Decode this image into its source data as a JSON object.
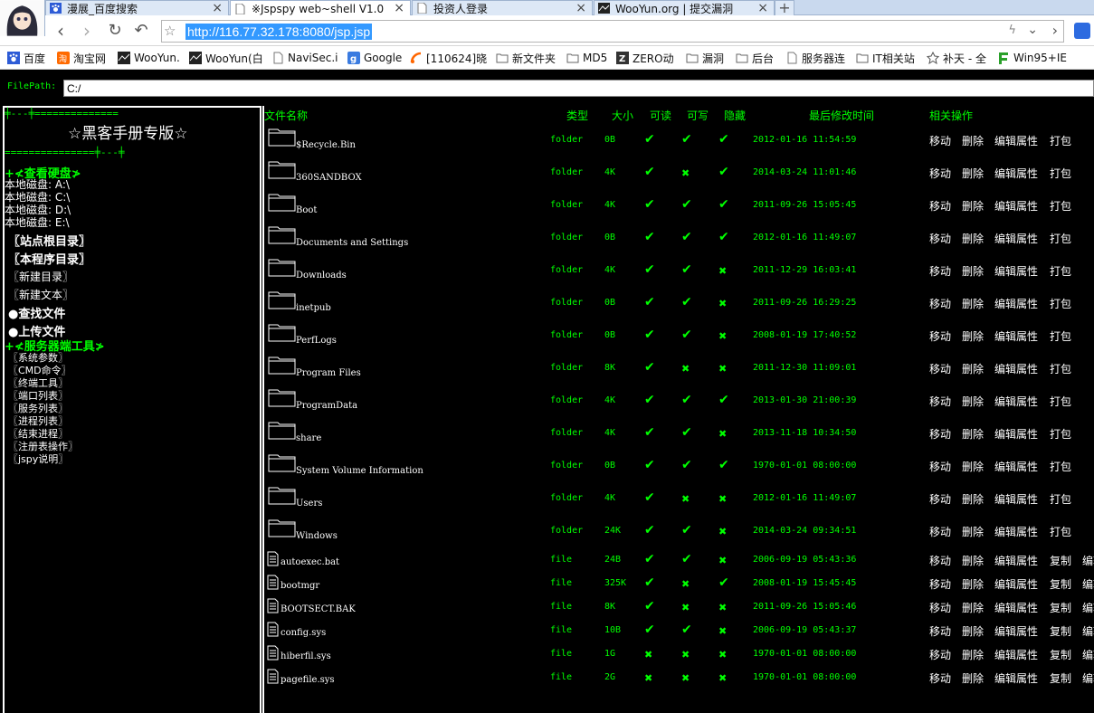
{
  "browser": {
    "tabs": [
      {
        "title": "漫展_百度搜索",
        "close": "×"
      },
      {
        "title": "※Jspspy web~shell V1.0",
        "close": "×"
      },
      {
        "title": "投资人登录",
        "close": "×"
      },
      {
        "title": "WooYun.org | 提交漏洞",
        "close": "×"
      }
    ],
    "new_tab": "+",
    "url": "http://116.77.32.178:8080/jsp.jsp",
    "bookmarks": [
      "百度",
      "淘宝网",
      "WooYun.",
      "WooYun(白",
      "NaviSec.i",
      "Google",
      "[110624]晓",
      "新文件夹",
      "MD5",
      "ZERO动",
      "漏洞",
      "后台",
      "服务器连",
      "IT相关站",
      "补天 - 全",
      "Win95+IE"
    ]
  },
  "filepath": {
    "label": "FilePath:",
    "value": "C:/"
  },
  "sidebar": {
    "top_deco": "╪---╪==============",
    "brand": "☆黑客手册专版☆",
    "bottom_deco": "===============╪---╪",
    "disks_heading": "+≮查看硬盘≯",
    "disks": [
      "本地磁盘: A:\\",
      "本地磁盘: C:\\",
      "本地磁盘: D:\\",
      "本地磁盘: E:\\"
    ],
    "site_root": "〖站点根目录〗",
    "program_dir": "〖本程序目录〗",
    "new_dir": "〖新建目录〗",
    "new_text": "〖新建文本〗",
    "search_file": "●查找文件",
    "upload_file": "●上传文件",
    "server_tools_heading": "+≮服务器端工具≯",
    "tools": [
      "〖系统参数〗",
      "〖CMD命令〗",
      "〖终端工具〗",
      "〖端口列表〗",
      "〖服务列表〗",
      "〖进程列表〗",
      "〖结束进程〗",
      "〖注册表操作〗",
      "〖jspy说明〗"
    ]
  },
  "table": {
    "headers": {
      "name": "文件名称",
      "type": "类型",
      "size": "大小",
      "read": "可读",
      "write": "可写",
      "hidden": "隐藏",
      "mtime": "最后修改时间",
      "ops": "相关操作"
    },
    "check_mark": "✔",
    "cross_mark": "✖",
    "folder_ops": [
      "移动",
      "删除",
      "编辑属性",
      "打包"
    ],
    "file_ops": [
      "移动",
      "删除",
      "编辑属性",
      "复制",
      "编辑"
    ],
    "folders": [
      {
        "name": "$Recycle.Bin",
        "type": "folder",
        "size": "0B",
        "r": true,
        "w": true,
        "h": true,
        "mtime": "2012-01-16 11:54:59"
      },
      {
        "name": "360SANDBOX",
        "type": "folder",
        "size": "4K",
        "r": true,
        "w": false,
        "h": true,
        "mtime": "2014-03-24 11:01:46"
      },
      {
        "name": "Boot",
        "type": "folder",
        "size": "4K",
        "r": true,
        "w": true,
        "h": true,
        "mtime": "2011-09-26 15:05:45"
      },
      {
        "name": "Documents and Settings",
        "type": "folder",
        "size": "0B",
        "r": true,
        "w": true,
        "h": true,
        "mtime": "2012-01-16 11:49:07"
      },
      {
        "name": "Downloads",
        "type": "folder",
        "size": "4K",
        "r": true,
        "w": true,
        "h": false,
        "mtime": "2011-12-29 16:03:41"
      },
      {
        "name": "inetpub",
        "type": "folder",
        "size": "0B",
        "r": true,
        "w": true,
        "h": false,
        "mtime": "2011-09-26 16:29:25"
      },
      {
        "name": "PerfLogs",
        "type": "folder",
        "size": "0B",
        "r": true,
        "w": true,
        "h": false,
        "mtime": "2008-01-19 17:40:52"
      },
      {
        "name": "Program Files",
        "type": "folder",
        "size": "8K",
        "r": true,
        "w": false,
        "h": false,
        "mtime": "2011-12-30 11:09:01"
      },
      {
        "name": "ProgramData",
        "type": "folder",
        "size": "4K",
        "r": true,
        "w": true,
        "h": true,
        "mtime": "2013-01-30 21:00:39"
      },
      {
        "name": "share",
        "type": "folder",
        "size": "4K",
        "r": true,
        "w": true,
        "h": false,
        "mtime": "2013-11-18 10:34:50"
      },
      {
        "name": "System Volume Information",
        "type": "folder",
        "size": "0B",
        "r": true,
        "w": true,
        "h": true,
        "mtime": "1970-01-01 08:00:00"
      },
      {
        "name": "Users",
        "type": "folder",
        "size": "4K",
        "r": true,
        "w": false,
        "h": false,
        "mtime": "2012-01-16 11:49:07"
      },
      {
        "name": "Windows",
        "type": "folder",
        "size": "24K",
        "r": true,
        "w": true,
        "h": false,
        "mtime": "2014-03-24 09:34:51"
      }
    ],
    "files": [
      {
        "name": "autoexec.bat",
        "type": "file",
        "size": "24B",
        "r": true,
        "w": true,
        "h": false,
        "mtime": "2006-09-19 05:43:36"
      },
      {
        "name": "bootmgr",
        "type": "file",
        "size": "325K",
        "r": true,
        "w": false,
        "h": true,
        "mtime": "2008-01-19 15:45:45"
      },
      {
        "name": "BOOTSECT.BAK",
        "type": "file",
        "size": "8K",
        "r": true,
        "w": false,
        "h": false,
        "mtime": "2011-09-26 15:05:46"
      },
      {
        "name": "config.sys",
        "type": "file",
        "size": "10B",
        "r": true,
        "w": true,
        "h": false,
        "mtime": "2006-09-19 05:43:37"
      },
      {
        "name": "hiberfil.sys",
        "type": "file",
        "size": "1G",
        "r": false,
        "w": false,
        "h": false,
        "mtime": "1970-01-01 08:00:00"
      },
      {
        "name": "pagefile.sys",
        "type": "file",
        "size": "2G",
        "r": false,
        "w": false,
        "h": false,
        "mtime": "1970-01-01 08:00:00"
      }
    ]
  },
  "colors": {
    "accent_green": "#00ff00",
    "background": "#000000",
    "text_white": "#ffffff",
    "url_highlight": "#3399ff"
  }
}
